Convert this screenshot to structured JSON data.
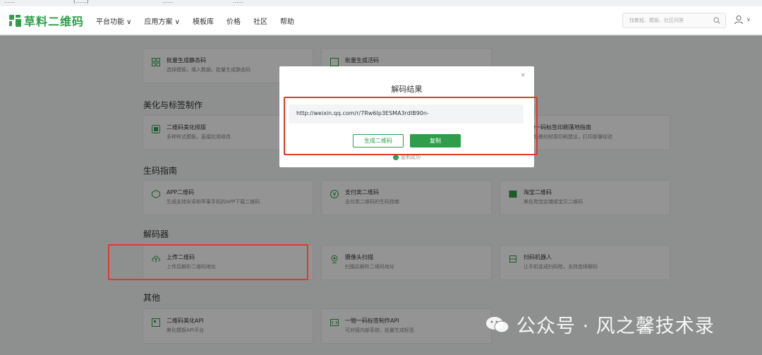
{
  "browser": {
    "bookmarks": [
      "......",
      "(......)",
      "......",
      "......"
    ]
  },
  "header": {
    "logo_text": "草料二维码",
    "nav": [
      "平台功能 ∨",
      "应用方案 ∨",
      "模板库",
      "价格",
      "社区",
      "帮助"
    ],
    "search_placeholder": "找教程、模板、社区问答"
  },
  "sections": [
    {
      "title": "",
      "cards": [
        {
          "title": "批量生成静态码",
          "desc": "选择模板，填入数据，批量生成静态码",
          "icon": "grid-icon"
        },
        {
          "title": "批量生成活码",
          "desc": "",
          "icon": "grid-icon"
        }
      ]
    },
    {
      "title": "美化与标签制作",
      "cards": [
        {
          "title": "二维码美化排版",
          "desc": "多种样式模板，直接应用修改",
          "icon": "palette-icon"
        },
        {
          "title": "一物一码标签印刷落地指南",
          "desc": "不同场景的材质印刷建议，打印部署经验",
          "icon": "print-icon"
        }
      ]
    },
    {
      "title": "生码指南",
      "cards": [
        {
          "title": "APP二维码",
          "desc": "生成支持安卓和苹果手机的APP下载二维码",
          "icon": "app-icon"
        },
        {
          "title": "支付类二维码",
          "desc": "支付类二维码的生码指南",
          "icon": "yen-icon"
        },
        {
          "title": "淘宝二维码",
          "desc": "美化淘宝店铺或宝贝二维码",
          "icon": "taobao-icon"
        }
      ]
    },
    {
      "title": "解码器",
      "cards": [
        {
          "title": "上传二维码",
          "desc": "上传后解析二维码地址",
          "icon": "upload-icon"
        },
        {
          "title": "摄像头扫描",
          "desc": "扫描后解析二维码地址",
          "icon": "camera-icon"
        },
        {
          "title": "扫码机器人",
          "desc": "让手机变成扫码枪，支持连续解码",
          "icon": "scanner-icon"
        }
      ]
    },
    {
      "title": "其他",
      "cards": [
        {
          "title": "二维码美化API",
          "desc": "美化模板API平台",
          "icon": "api-icon"
        },
        {
          "title": "一物一码标签制作API",
          "desc": "可对接内部系统，批量生成标签",
          "icon": "code-icon"
        }
      ]
    }
  ],
  "modal": {
    "title": "解码结果",
    "close": "×",
    "url": "http://weixin.qq.com/r/7Rw6Ip3ESMA3rdIB90n-",
    "generate_label": "生成二维码",
    "copy_label": "复制",
    "success_text": "复制成功"
  },
  "watermark": {
    "text": "公众号 · 风之馨技术录"
  },
  "colors": {
    "brand_green": "#2e9e4a",
    "highlight_red": "#e03a2f"
  }
}
